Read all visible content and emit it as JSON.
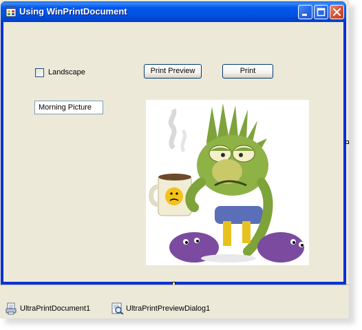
{
  "window": {
    "title": "Using WinPrintDocument",
    "icon": "form-icon",
    "caption_buttons": [
      "minimize",
      "maximize",
      "close"
    ]
  },
  "form": {
    "landscape_checkbox": {
      "label": "Landscape",
      "checked": false
    },
    "print_preview_button": "Print Preview",
    "print_button": "Print",
    "picture_name_textbox": {
      "value": "Morning Picture"
    },
    "picture": {
      "description_icon": "cartoon-monster-with-coffee-mug"
    }
  },
  "component_tray": {
    "items": [
      {
        "label": "UltraPrintDocument1",
        "icon": "print-document-icon"
      },
      {
        "label": "UltraPrintPreviewDialog1",
        "icon": "print-preview-dialog-icon"
      }
    ]
  },
  "colors": {
    "titlebar": "#0054e3",
    "client": "#ece9d8",
    "close_button": "#d65234"
  }
}
